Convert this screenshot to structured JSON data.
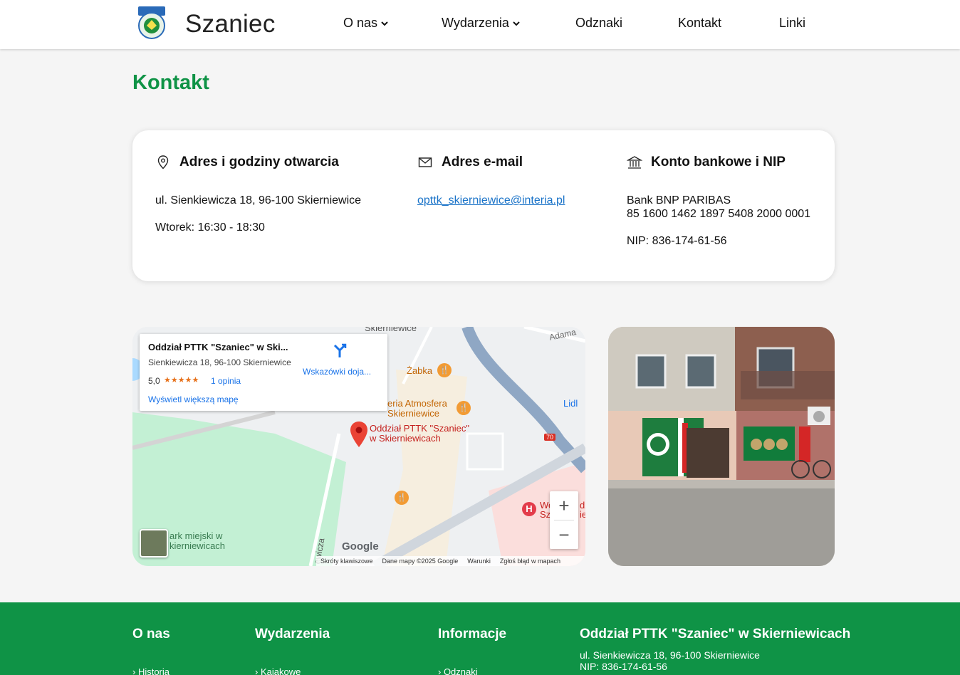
{
  "header": {
    "brand": "Szaniec",
    "nav": [
      {
        "label": "O nas"
      },
      {
        "label": "Wydarzenia"
      },
      {
        "label": "Odznaki"
      },
      {
        "label": "Kontakt"
      },
      {
        "label": "Linki"
      }
    ]
  },
  "page": {
    "title": "Kontakt"
  },
  "contact": {
    "address": {
      "heading": "Adres i godziny otwarcia",
      "street": "ul. Sienkiewicza 18, 96-100 Skierniewice",
      "hours": "Wtorek: 16:30 - 18:30",
      "icon": "location-pin-icon"
    },
    "email": {
      "heading": "Adres e-mail",
      "value": "opttk_skierniewice@interia.pl",
      "icon": "envelope-icon"
    },
    "bank": {
      "heading": "Konto bankowe i NIP",
      "bank_name": "Bank BNP PARIBAS",
      "account": "85 1600 1462 1897 5408 2000 0001",
      "nip": "NIP: 836-174-61-56",
      "icon": "bank-icon"
    }
  },
  "map": {
    "place_name": "Oddział PTTK \"Szaniec\" w Ski...",
    "place_address": "Sienkiewicza 18, 96-100 Skierniewice",
    "rating": "5,0",
    "stars": "★★★★★",
    "reviews": "1 opinia",
    "bigger_map": "Wyświetl większą mapę",
    "directions": "Wskazówki doja...",
    "marker_label_1": "Oddział PTTK \"Szaniec\"",
    "marker_label_2": "w Skierniewicach",
    "poi_zabka": "Żabka",
    "poi_atmosfera_1": "eria Atmosfera",
    "poi_atmosfera_2": "Skierniewice",
    "poi_lidl": "Lidl",
    "poi_park_1": "ark miejski w",
    "poi_park_2": "kierniewicach",
    "road_70": "70",
    "street_adama": "Adama",
    "street_skierniewice": "Skierniewice",
    "poi_hospital_1": "We",
    "poi_hospital_2": "Sz",
    "poi_hospital_3": "dz",
    "poi_hospital_4": "ie",
    "street_bottom": "ewicza",
    "google": "Google",
    "footer": [
      "Skróty klawiszowe",
      "Dane mapy ©2025 Google",
      "Warunki",
      "Zgłoś błąd w mapach"
    ],
    "zoom_in": "+",
    "zoom_out": "−"
  },
  "footer": {
    "col1": {
      "heading": "O nas",
      "link": "› Historia"
    },
    "col2": {
      "heading": "Wydarzenia",
      "link": "› Kajakowe"
    },
    "col3": {
      "heading": "Informacje",
      "link": "› Odznaki"
    },
    "col4": {
      "heading": "Oddział PTTK \"Szaniec\" w Skierniewicach",
      "address": "ul. Sienkiewicza 18, 96-100 Skierniewice",
      "nip": "NIP: 836-174-61-56"
    }
  },
  "colors": {
    "brand_green": "#0f9346",
    "link_blue": "#1a73c8"
  }
}
